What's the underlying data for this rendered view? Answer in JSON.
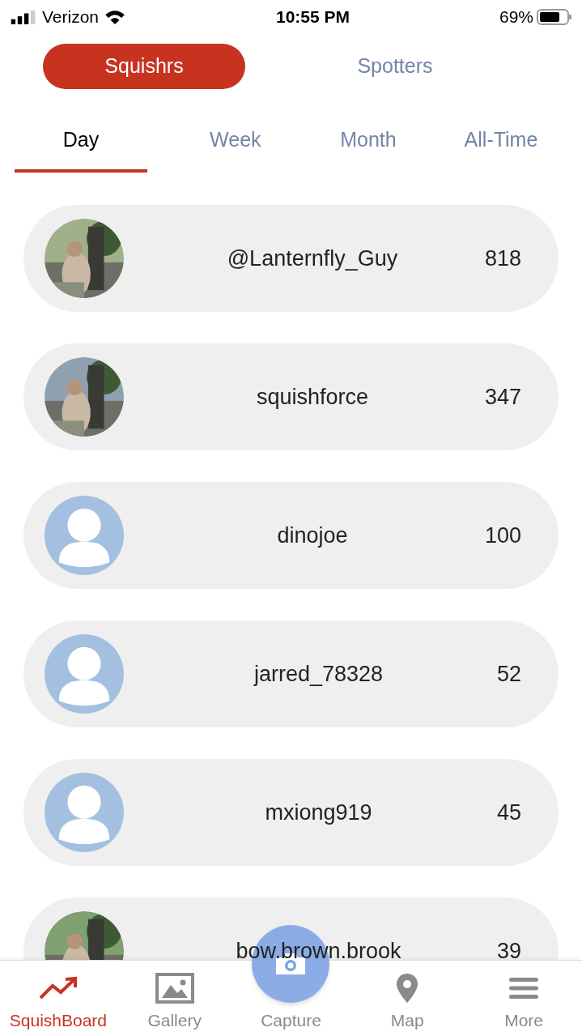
{
  "status_bar": {
    "carrier": "Verizon",
    "time": "10:55 PM",
    "battery": "69%"
  },
  "segments": [
    {
      "label": "Squishrs",
      "selected": true
    },
    {
      "label": "Spotters",
      "selected": false
    }
  ],
  "tabs": [
    {
      "label": "Day",
      "selected": true
    },
    {
      "label": "Week",
      "selected": false
    },
    {
      "label": "Month",
      "selected": false
    },
    {
      "label": "All-Time",
      "selected": false
    }
  ],
  "leaderboard": [
    {
      "kind": "picture",
      "name": "@Lanternfly_Guy",
      "score": "818"
    },
    {
      "kind": "picture",
      "name": "squishforce",
      "score": "347"
    },
    {
      "kind": "default",
      "name": "dinojoe",
      "score": "100"
    },
    {
      "kind": "default",
      "name": "jarred_78328",
      "score": "52"
    },
    {
      "kind": "default",
      "name": "mxiong919",
      "score": "45"
    },
    {
      "kind": "picture",
      "name": "bow.brown.brook",
      "score": "39"
    }
  ],
  "tab_bar": [
    {
      "kind": "trend",
      "label": "SquishBoard",
      "selected": true
    },
    {
      "kind": "gallery",
      "label": "Gallery",
      "selected": false
    },
    {
      "kind": "capture",
      "label": "Capture",
      "selected": false
    },
    {
      "kind": "map",
      "label": "Map",
      "selected": false
    },
    {
      "kind": "more",
      "label": "More",
      "selected": false
    }
  ]
}
